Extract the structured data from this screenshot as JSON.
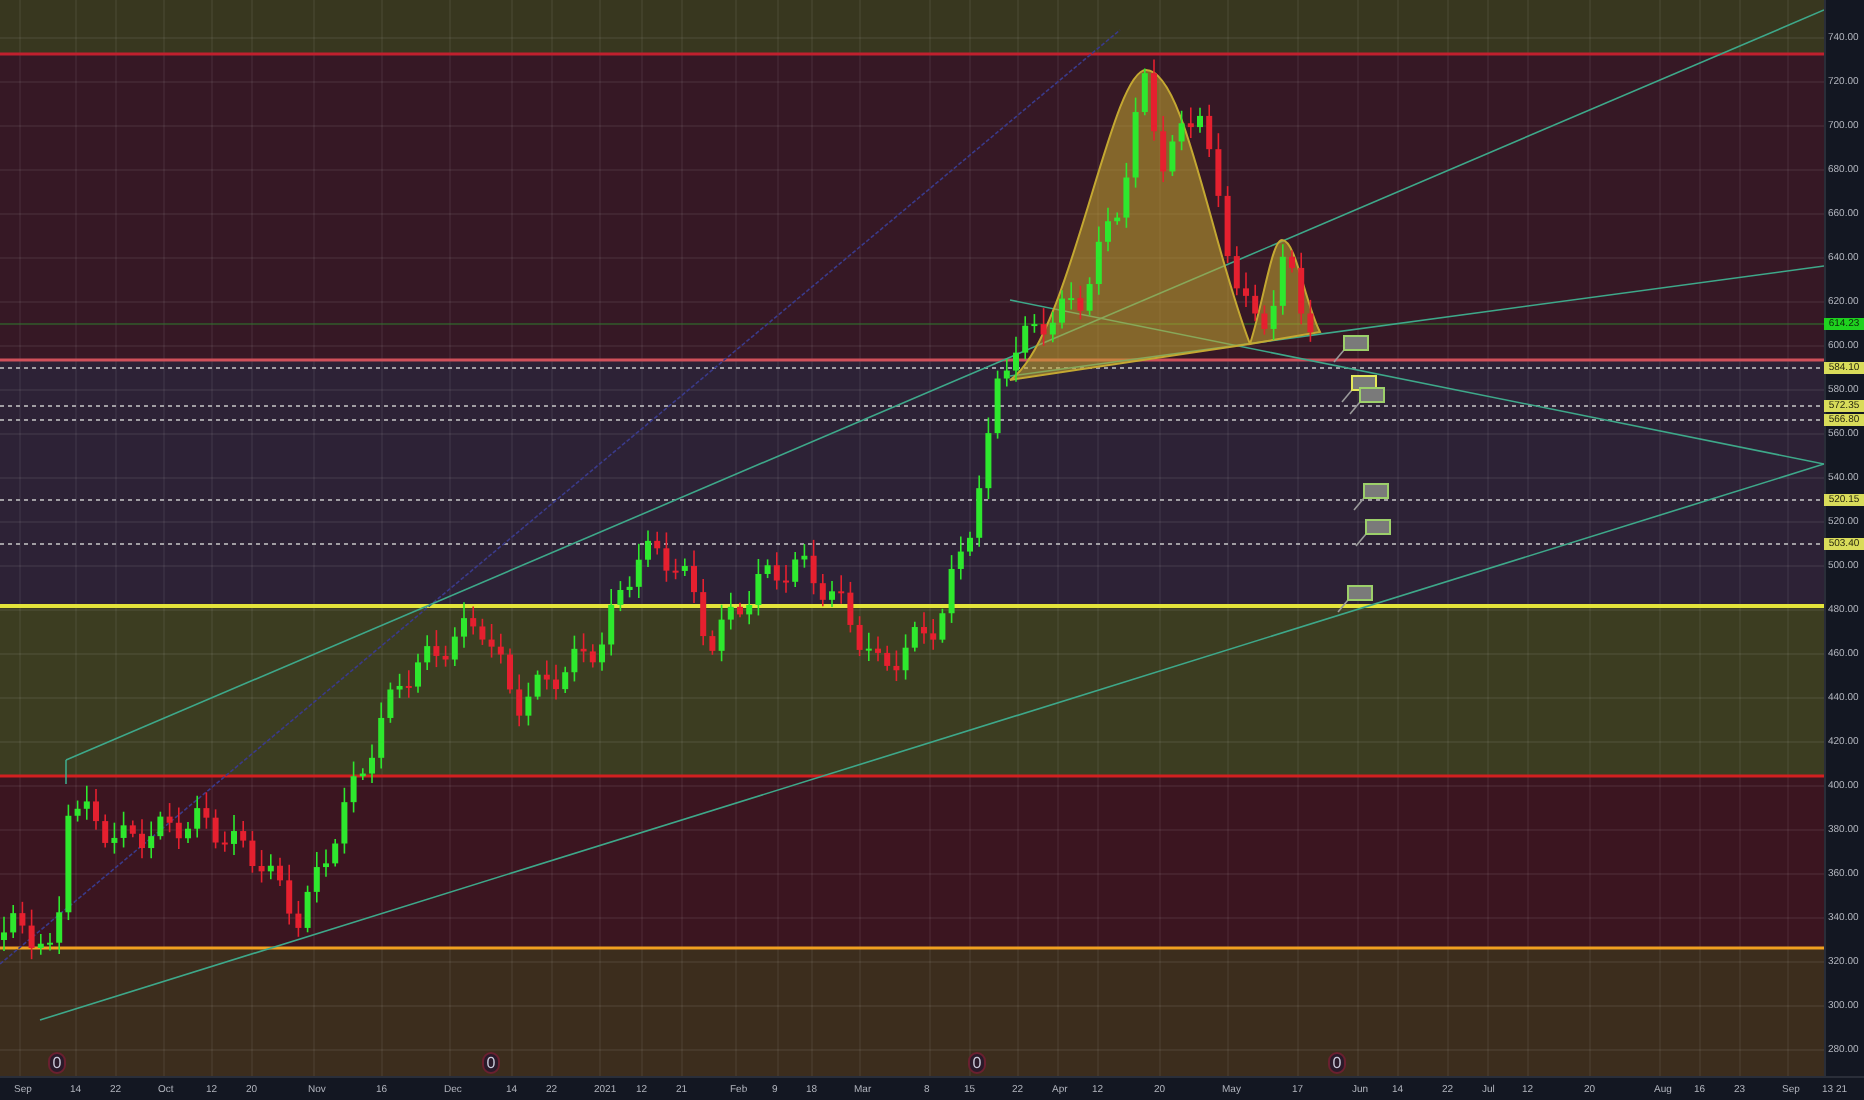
{
  "chart": {
    "price_axis": {
      "labels": [
        "740.00",
        "720.00",
        "700.00",
        "680.00",
        "660.00",
        "640.00",
        "620.00",
        "600.00",
        "580.00",
        "560.00",
        "540.00",
        "520.00",
        "500.00",
        "480.00",
        "460.00",
        "440.00",
        "420.00",
        "400.00",
        "380.00",
        "360.00",
        "340.00",
        "320.00",
        "300.00",
        "280.00"
      ]
    },
    "price_tags": [
      {
        "text": "614.23",
        "kind": "last"
      },
      {
        "text": "584.10",
        "kind": "level"
      },
      {
        "text": "572.35",
        "kind": "level"
      },
      {
        "text": "566.80",
        "kind": "level"
      },
      {
        "text": "520.15",
        "kind": "level"
      },
      {
        "text": "503.40",
        "kind": "level"
      }
    ],
    "time_axis": {
      "labels": [
        "Sep",
        "14",
        "22",
        "Oct",
        "12",
        "20",
        "Nov",
        "16",
        "Dec",
        "14",
        "22",
        "2021",
        "12",
        "21",
        "Feb",
        "9",
        "18",
        "Mar",
        "8",
        "15",
        "22",
        "Apr",
        "12",
        "20",
        "May",
        "17",
        "Jun",
        "14",
        "22",
        "Jul",
        "12",
        "20",
        "Aug",
        "16",
        "23",
        "Sep",
        "13",
        "21"
      ]
    },
    "event_markers": [
      "0",
      "0",
      "0",
      "0"
    ]
  }
}
